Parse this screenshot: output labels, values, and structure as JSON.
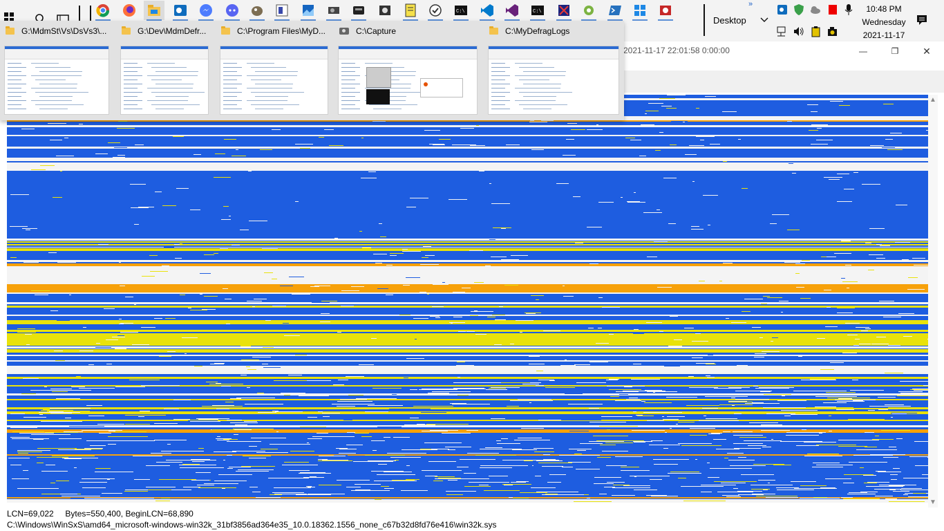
{
  "taskbar": {
    "desktop_label": "Desktop",
    "more_label": "»",
    "pinned_icons": [
      "chrome-icon",
      "firefox-icon",
      "file-explorer-icon",
      "outlook-icon",
      "messenger-icon",
      "discord-icon",
      "gimp-icon",
      "paint-icon",
      "image-viewer-icon",
      "steam-icon",
      "tool-icon",
      "gpu-icon",
      "notepad-icon",
      "checklist-icon",
      "console-icon",
      "vscode-icon",
      "visual-studio-icon",
      "cmd-icon",
      "app-icon",
      "settings-icon",
      "powershell-icon",
      "grid-icon",
      "snipping-icon"
    ],
    "clock": {
      "time": "10:48 PM",
      "day": "Wednesday",
      "date": "2021-11-17"
    },
    "tray_icons": [
      "outlook-tray-icon",
      "shield-icon",
      "onedrive-icon",
      "red-app-icon",
      "microphone-icon",
      "network-icon",
      "volume-icon",
      "power-icon",
      "camera-icon"
    ]
  },
  "thumbnails": [
    {
      "title": "G:\\MdmSt\\Vs\\DsVs3\\...",
      "icon": "folder-icon"
    },
    {
      "title": "G:\\Dev\\MdmDefr...",
      "icon": "folder-icon"
    },
    {
      "title": "C:\\Program Files\\MyD...",
      "icon": "folder-icon"
    },
    {
      "title": "C:\\Capture",
      "icon": "camera-icon"
    },
    {
      "title": "C:\\MyDefragLogs",
      "icon": "folder-icon"
    }
  ],
  "app_window": {
    "title": "2021-11-17 22:01:58 0:00:00",
    "controls": {
      "minimize": "—",
      "restore": "❐",
      "close": "✕"
    }
  },
  "status": {
    "line1": "LCN=69,022     Bytes=550,400, BeginLCN=68,890",
    "line2": "C:\\Windows\\WinSxS\\amd64_microsoft-windows-win32k_31bf3856ad364e35_10.0.18362.1556_none_c67b32d8fd76e416\\win32k.sys"
  },
  "colors": {
    "used": "#1e5de0",
    "free": "#f4f4f4",
    "unmovable": "#e9e20a",
    "fragmented": "#f7a10a"
  }
}
